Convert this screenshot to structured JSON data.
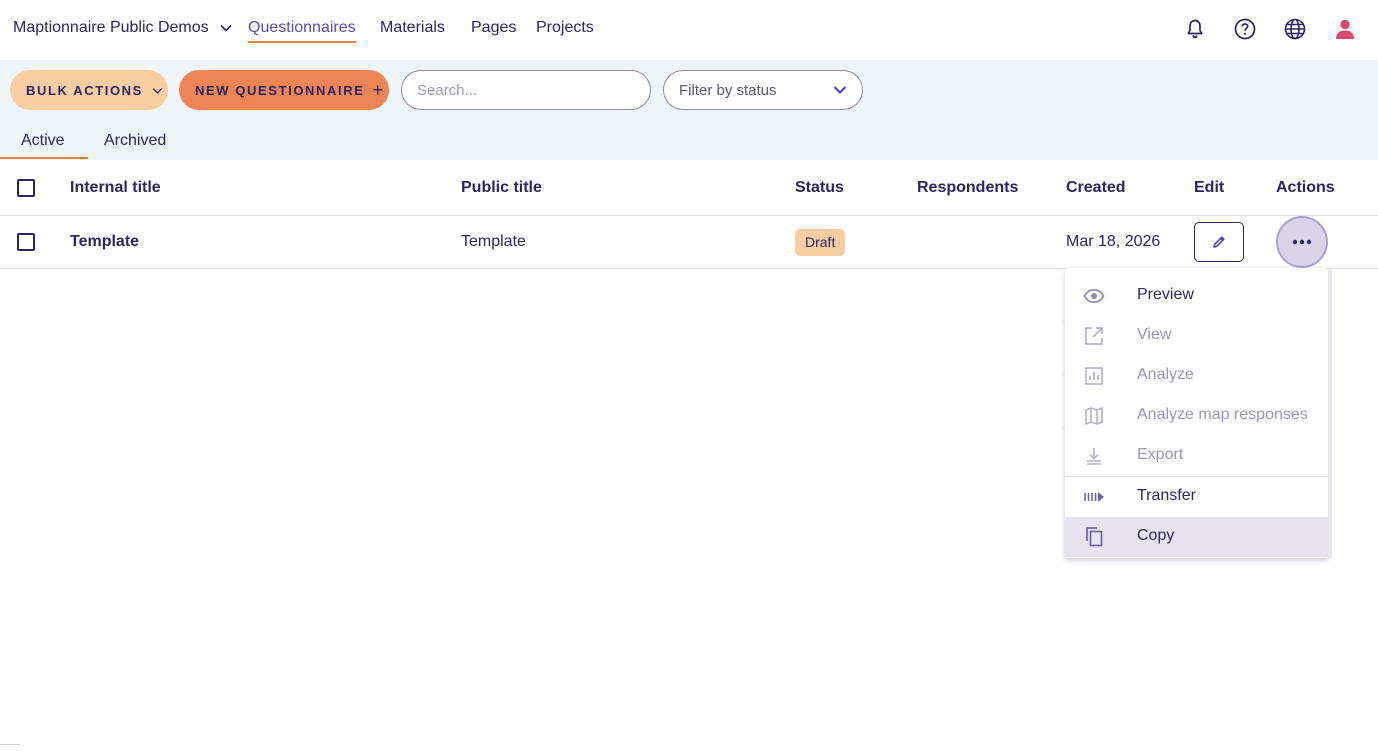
{
  "header": {
    "org_name": "Maptionnaire Public Demos",
    "nav": [
      "Questionnaires",
      "Materials",
      "Pages",
      "Projects"
    ],
    "active_nav": "Questionnaires",
    "icons": [
      "bell-icon",
      "help-icon",
      "globe-icon",
      "user-icon"
    ]
  },
  "toolbar": {
    "bulk_actions_label": "BULK ACTIONS",
    "new_questionnaire_label": "NEW QUESTIONNAIRE",
    "new_questionnaire_plus": "+",
    "search_placeholder": "Search...",
    "filter_label": "Filter by status"
  },
  "tabs": {
    "active": "Active",
    "archived": "Archived"
  },
  "table": {
    "columns": {
      "internal_title": "Internal title",
      "public_title": "Public title",
      "status": "Status",
      "respondents": "Respondents",
      "created": "Created",
      "edit": "Edit",
      "actions": "Actions"
    },
    "rows": [
      {
        "internal_title": "Template",
        "public_title": "Template",
        "status": "Draft",
        "respondents": "",
        "created": "Mar 18, 2026"
      }
    ]
  },
  "menu": {
    "items": [
      {
        "label": "Preview",
        "icon": "eye-icon",
        "enabled": true
      },
      {
        "label": "View",
        "icon": "external-link-icon",
        "enabled": false
      },
      {
        "label": "Analyze",
        "icon": "chart-icon",
        "enabled": false
      },
      {
        "label": "Analyze map responses",
        "icon": "map-icon",
        "enabled": false
      },
      {
        "label": "Export",
        "icon": "download-icon",
        "enabled": false
      },
      {
        "label": "Transfer",
        "icon": "transfer-icon",
        "enabled": true
      },
      {
        "label": "Copy",
        "icon": "copy-icon",
        "enabled": true,
        "hovered": true
      }
    ]
  },
  "colors": {
    "primary_text": "#2b2566",
    "accent_orange": "#e8843f",
    "bulk_button": "#f8cda0",
    "new_button": "#ef8454",
    "band_bg": "#eff4f9",
    "user_icon": "#e04a6a"
  }
}
